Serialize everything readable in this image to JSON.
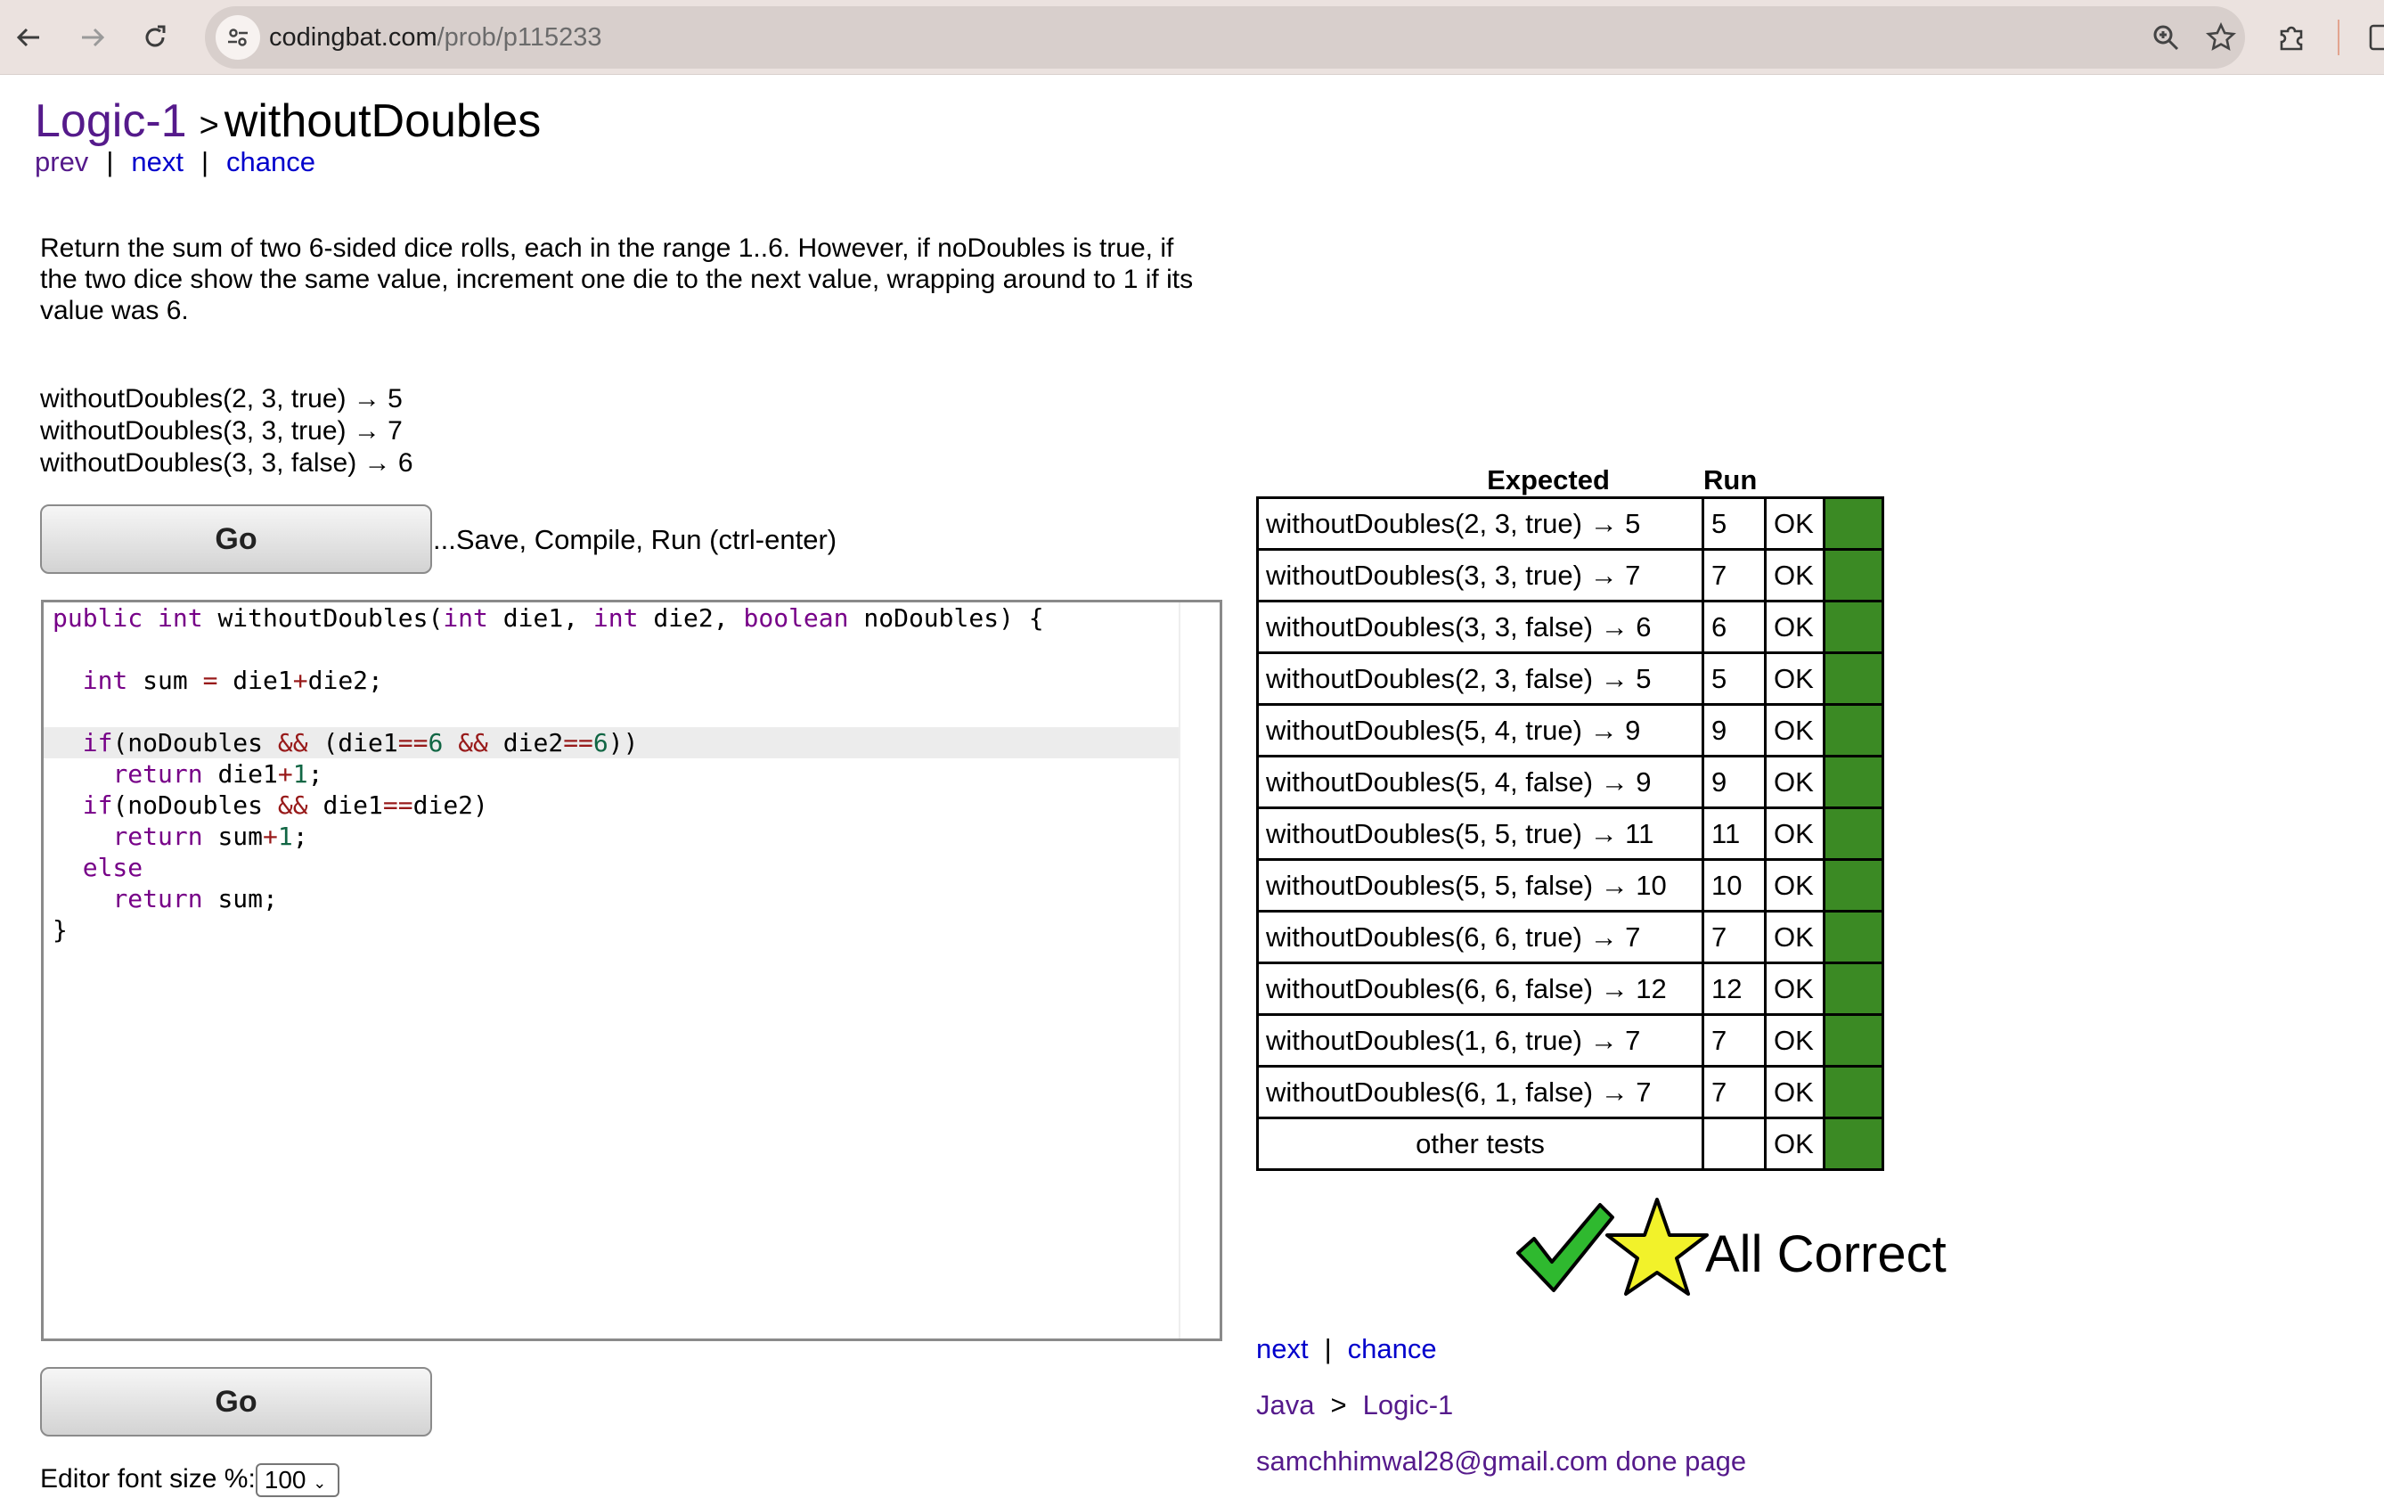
{
  "browser": {
    "url_host": "codingbat.com",
    "url_path": "/prob/p115233"
  },
  "header": {
    "section_link": "Logic-1",
    "separator": ">",
    "title": "withoutDoubles"
  },
  "subnav": {
    "prev": "prev",
    "next": "next",
    "chance": "chance",
    "sep": "|"
  },
  "description": "Return the sum of two 6-sided dice rolls, each in the range 1..6. However, if noDoubles is true, if the two dice show the same value, increment one die to the next value, wrapping around to 1 if its value was 6.",
  "examples": [
    "withoutDoubles(2, 3, true) → 5",
    "withoutDoubles(3, 3, true) → 7",
    "withoutDoubles(3, 3, false) → 6"
  ],
  "go_button": "Go",
  "go_hint": "...Save, Compile, Run (ctrl-enter)",
  "editor_font_label": "Editor font size %:",
  "editor_font_value": "100",
  "results": {
    "header_expected": "Expected",
    "header_run": "Run",
    "rows": [
      {
        "expected": "withoutDoubles(2, 3, true) → 5",
        "run": "5",
        "status": "OK"
      },
      {
        "expected": "withoutDoubles(3, 3, true) → 7",
        "run": "7",
        "status": "OK"
      },
      {
        "expected": "withoutDoubles(3, 3, false) → 6",
        "run": "6",
        "status": "OK"
      },
      {
        "expected": "withoutDoubles(2, 3, false) → 5",
        "run": "5",
        "status": "OK"
      },
      {
        "expected": "withoutDoubles(5, 4, true) → 9",
        "run": "9",
        "status": "OK"
      },
      {
        "expected": "withoutDoubles(5, 4, false) → 9",
        "run": "9",
        "status": "OK"
      },
      {
        "expected": "withoutDoubles(5, 5, true) → 11",
        "run": "11",
        "status": "OK"
      },
      {
        "expected": "withoutDoubles(5, 5, false) → 10",
        "run": "10",
        "status": "OK"
      },
      {
        "expected": "withoutDoubles(6, 6, true) → 7",
        "run": "7",
        "status": "OK"
      },
      {
        "expected": "withoutDoubles(6, 6, false) → 12",
        "run": "12",
        "status": "OK"
      },
      {
        "expected": "withoutDoubles(1, 6, true) → 7",
        "run": "7",
        "status": "OK"
      },
      {
        "expected": "withoutDoubles(6, 1, false) → 7",
        "run": "7",
        "status": "OK"
      },
      {
        "expected": "other tests",
        "run": "",
        "status": "OK"
      }
    ],
    "pass_color": "#3b8a24"
  },
  "result_banner": "All Correct",
  "footer": {
    "next": "next",
    "chance": "chance",
    "sep": "|",
    "lang": "Java",
    "gt": ">",
    "section": "Logic-1",
    "user_link": "samchhimwal28@gmail.com done page"
  },
  "icons": {
    "back": "back-arrow-icon",
    "forward": "forward-arrow-icon",
    "reload": "reload-icon",
    "site_info": "tune-icon",
    "zoom": "zoom-icon",
    "bookmark": "star-icon",
    "extensions": "puzzle-icon",
    "side_panel": "side-panel-icon",
    "check": "check-icon",
    "star": "star-icon"
  }
}
